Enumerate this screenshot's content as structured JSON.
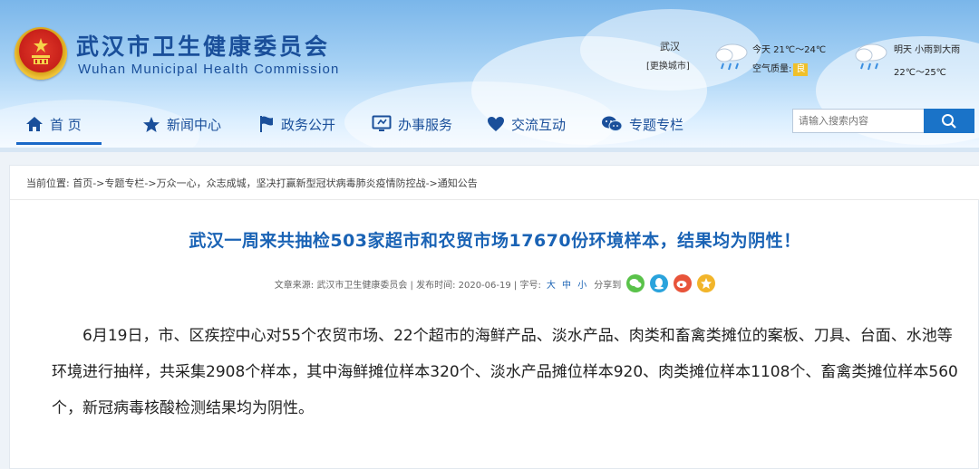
{
  "header": {
    "title": "武汉市卫生健康委员会",
    "subtitle": "Wuhan Municipal Health Commission",
    "colors": {
      "brand_blue": "#1a4f9a",
      "accent_blue": "#1a73c8",
      "title_blue": "#1a63b5"
    }
  },
  "weather": {
    "city": "武汉",
    "change_city": "[更换城市]",
    "today": "今天  21℃～24℃",
    "air_quality_label": "空气质量:",
    "air_quality_value": "良",
    "tomorrow": "明天  小雨到大雨",
    "tomorrow_temp": "22℃～25℃"
  },
  "nav": {
    "items": [
      {
        "label": "首 页",
        "icon": "home-icon"
      },
      {
        "label": "新闻中心",
        "icon": "star-icon"
      },
      {
        "label": "政务公开",
        "icon": "flag-icon"
      },
      {
        "label": "办事服务",
        "icon": "monitor-icon"
      },
      {
        "label": "交流互动",
        "icon": "heart-icon"
      },
      {
        "label": "专题专栏",
        "icon": "wechat-icon"
      }
    ],
    "search_placeholder": "请输入搜索内容"
  },
  "breadcrumb": "当前位置:  首页->专题专栏->万众一心，众志成城，坚决打赢新型冠状病毒肺炎疫情防控战->通知公告",
  "article": {
    "title": "武汉一周来共抽检503家超市和农贸市场17670份环境样本，结果均为阴性！",
    "meta_source": "文章来源:  武汉市卫生健康委员会  | 发布时间:  2020-06-19  | 字号:",
    "meta_sizes": "大 中 小",
    "meta_share": "分享到",
    "body": "6月19日，市、区疾控中心对55个农贸市场、22个超市的海鲜产品、淡水产品、肉类和畜禽类摊位的案板、刀具、台面、水池等环境进行抽样，共采集2908个样本，其中海鲜摊位样本320个、淡水产品摊位样本920、肉类摊位样本1108个、畜禽类摊位样本560个，新冠病毒核酸检测结果均为阴性。"
  }
}
